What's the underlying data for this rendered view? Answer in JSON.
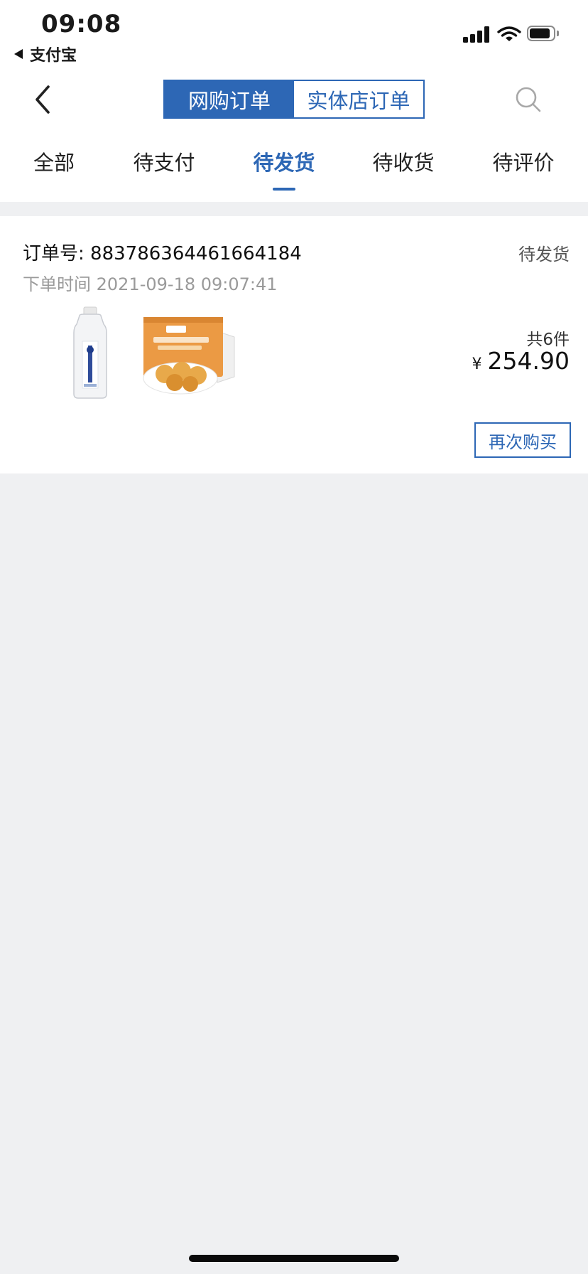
{
  "status_bar": {
    "time": "09:08",
    "back_app": "支付宝",
    "signal_icon": "cellular-signal-icon",
    "wifi_icon": "wifi-icon",
    "battery_icon": "battery-icon"
  },
  "header": {
    "back_icon": "chevron-left-icon",
    "segments": [
      {
        "label": "网购订单",
        "active": true
      },
      {
        "label": "实体店订单",
        "active": false
      }
    ],
    "search_icon": "search-icon"
  },
  "tabs": [
    {
      "label": "全部",
      "active": false
    },
    {
      "label": "待支付",
      "active": false
    },
    {
      "label": "待发货",
      "active": true
    },
    {
      "label": "待收货",
      "active": false
    },
    {
      "label": "待评价",
      "active": false
    }
  ],
  "order": {
    "number_label": "订单号: 883786364461664184",
    "status": "待发货",
    "time_label": "下单时间 2021-09-18 09:07:41",
    "items": [
      {
        "name": "milk-bottle-image"
      },
      {
        "name": "mooncake-box-image"
      }
    ],
    "count": "共6件",
    "currency": "¥",
    "total": "254.90",
    "rebuy_label": "再次购买"
  },
  "colors": {
    "accent": "#2d67b5",
    "page_bg": "#eff0f2",
    "card_bg": "#ffffff"
  }
}
